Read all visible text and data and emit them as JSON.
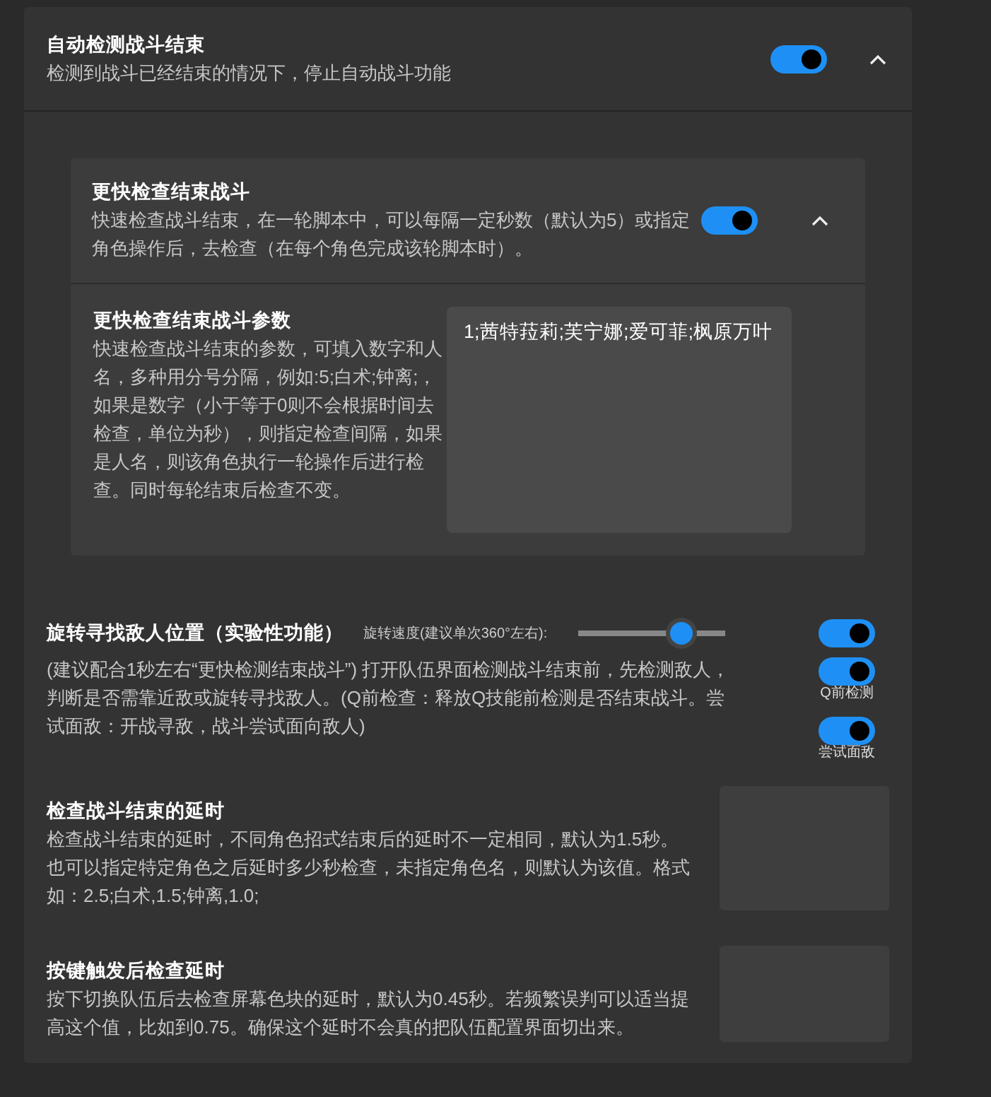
{
  "section": {
    "title": "自动检测战斗结束",
    "description": "检测到战斗已经结束的情况下，停止自动战斗功能",
    "enabled": true,
    "expanded": true
  },
  "subsection": {
    "title": "更快检查结束战斗",
    "description": "快速检查战斗结束，在一轮脚本中，可以每隔一定秒数（默认为5）或指定角色操作后，去检查（在每个角色完成该轮脚本时）。",
    "enabled": true,
    "expanded": true,
    "param": {
      "title": "更快检查结束战斗参数",
      "description": "快速检查战斗结束的参数，可填入数字和人名，多种用分号分隔，例如:5;白术;钟离;，如果是数字（小于等于0则不会根据时间去检查，单位为秒），则指定检查间隔，如果是人名，则该角色执行一轮操作后进行检查。同时每轮结束后检查不变。",
      "value": "1;茜特菈莉;芙宁娜;爱可菲;枫原万叶"
    }
  },
  "rotate_search": {
    "title": "旋转寻找敌人位置（实验性功能）",
    "slider": {
      "label": "旋转速度(建议单次360°左右):",
      "level": 0.7
    },
    "description": "(建议配合1秒左右“更快检测结束战斗”) 打开队伍界面检测战斗结束前，先检测敌人，判断是否需靠近敌或旋转寻找敌人。(Q前检查：释放Q技能前检测是否结束战斗。尝试面敌：开战寻敌，战斗尝试面向敌人)",
    "toggles": [
      {
        "on": true
      },
      {
        "label": "Q前检测",
        "on": true
      },
      {
        "label": "尝试面敌",
        "on": true
      }
    ]
  },
  "delay_settings": [
    {
      "title": "检查战斗结束的延时",
      "description": "检查战斗结束的延时，不同角色招式结束后的延时不一定相同，默认为1.5秒。也可以指定特定角色之后延时多少秒检查，未指定角色名，则默认为该值。格式如：2.5;白术,1.5;钟离,1.0;"
    },
    {
      "title": "按键触发后检查延时",
      "description": "按下切换队伍后去检查屏幕色块的延时，默认为0.45秒。若频繁误判可以适当提高这个值，比如到0.75。确保这个延时不会真的把队伍配置界面切出来。"
    }
  ]
}
